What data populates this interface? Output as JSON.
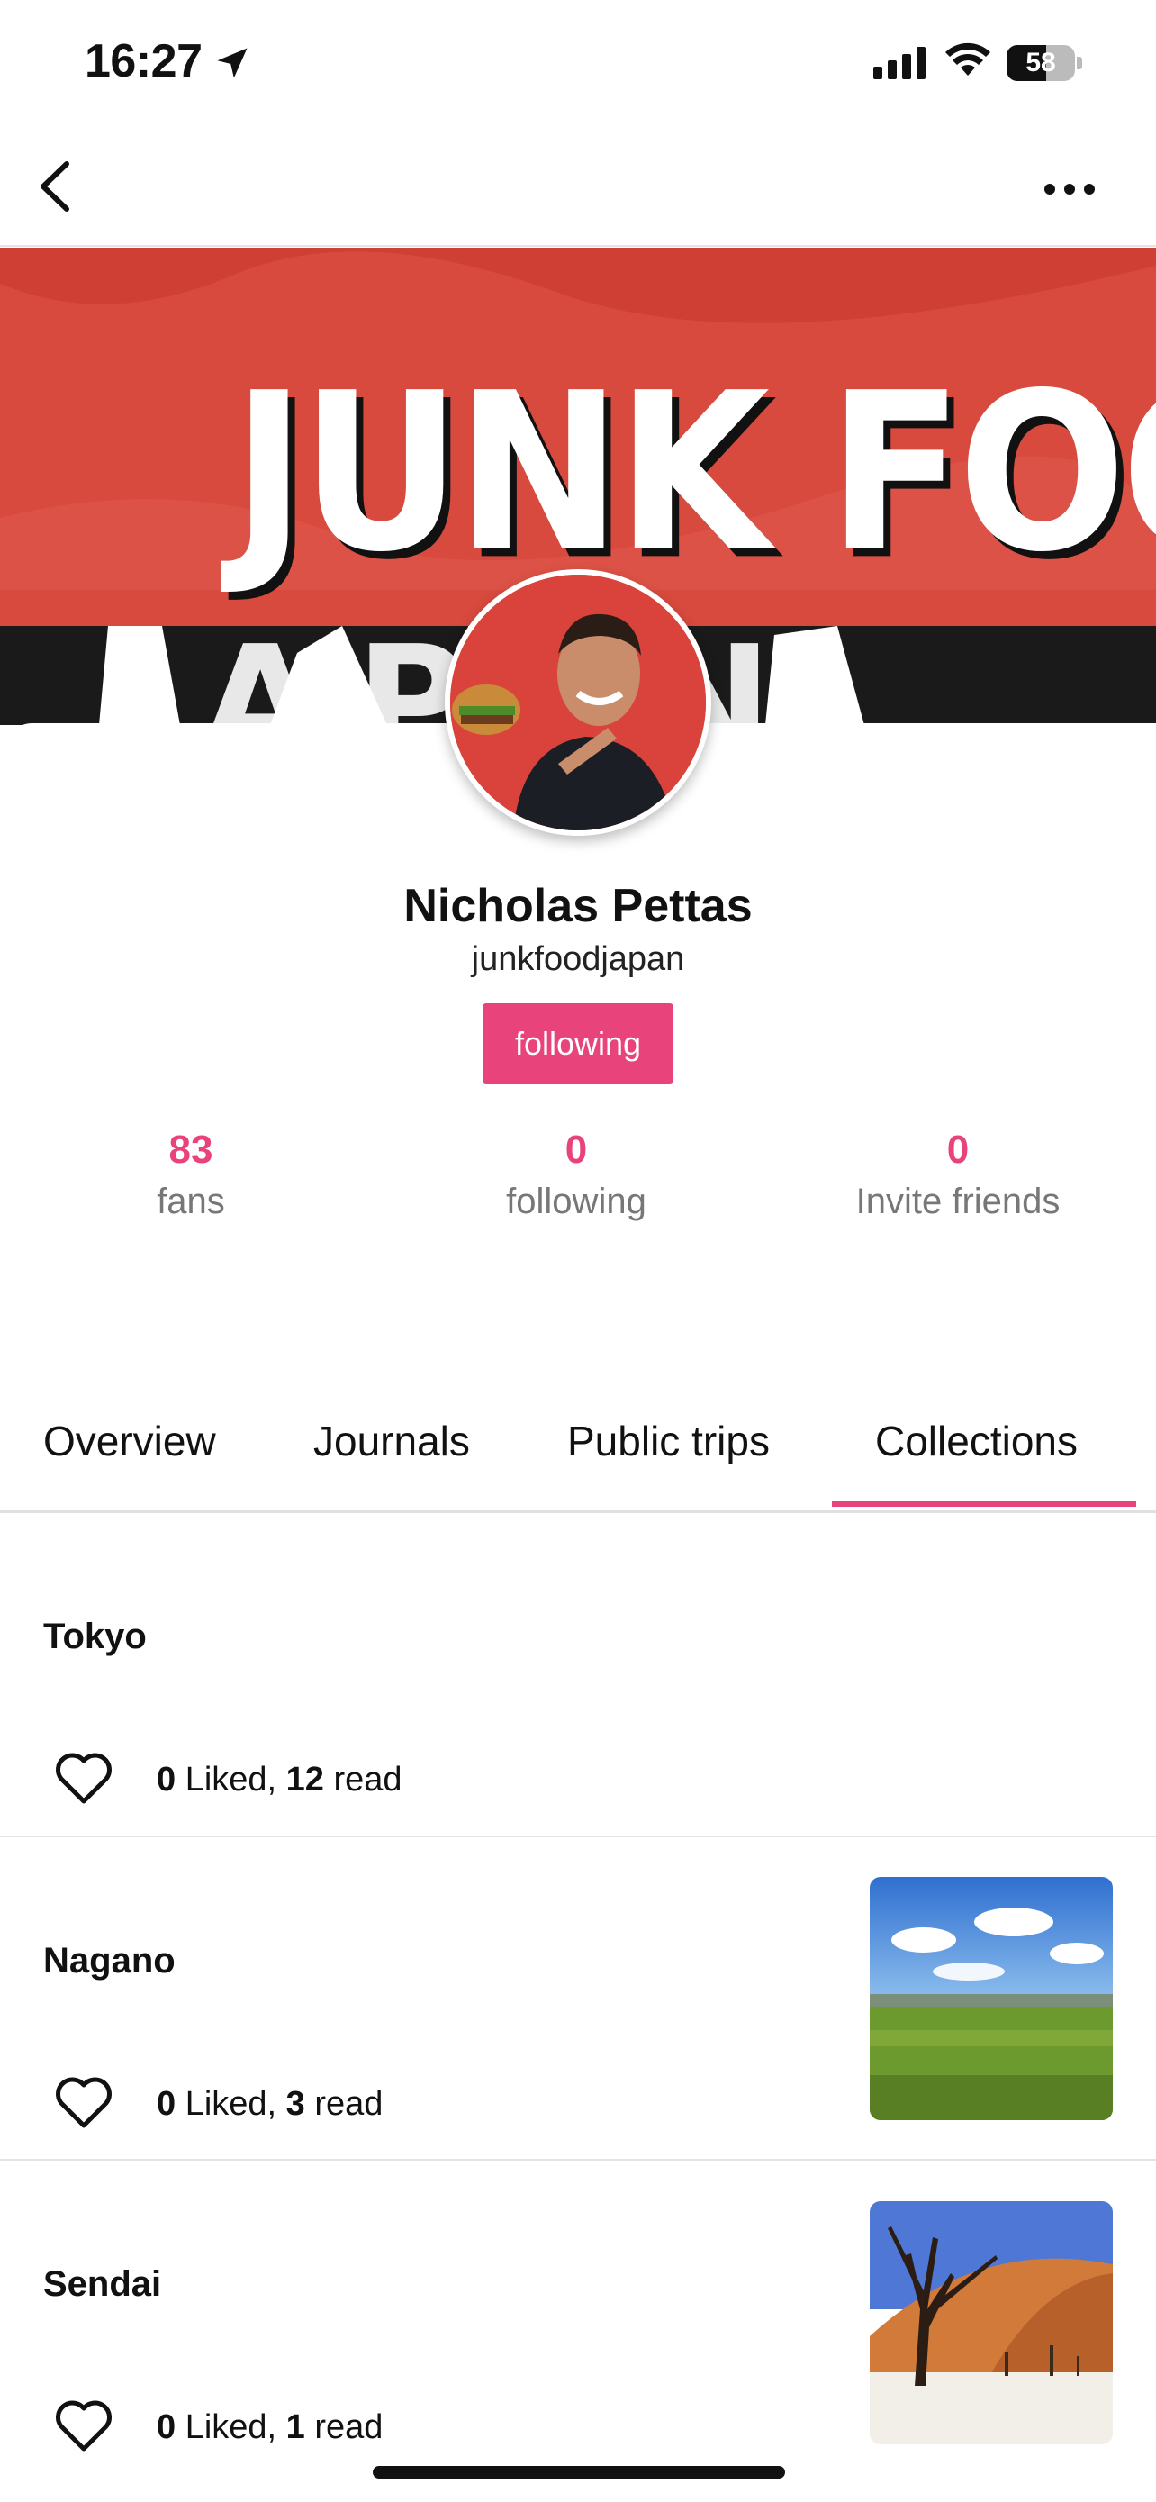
{
  "status_bar": {
    "time": "16:27",
    "battery": "58"
  },
  "cover": {
    "banner_text": "JUNK FOOD",
    "banner_sub_text": "JAPAN",
    "bg_color": "#d84a3e"
  },
  "profile": {
    "name": "Nicholas Pettas",
    "handle": "junkfoodjapan",
    "follow_button": "following",
    "stats": [
      {
        "value": "83",
        "label": "fans"
      },
      {
        "value": "0",
        "label": "following"
      },
      {
        "value": "0",
        "label": "Invite friends"
      }
    ]
  },
  "tabs": [
    {
      "label": "Overview"
    },
    {
      "label": "Journals"
    },
    {
      "label": "Public trips"
    },
    {
      "label": "Collections"
    }
  ],
  "active_tab": "Collections",
  "collections": [
    {
      "title": "Tokyo",
      "liked": "0",
      "liked_label": " Liked, ",
      "read": "12",
      "read_label": " read",
      "thumbnail": "none"
    },
    {
      "title": "Nagano",
      "liked": "0",
      "liked_label": " Liked, ",
      "read": "3",
      "read_label": " read",
      "thumbnail": "green-plain-landscape"
    },
    {
      "title": "Sendai",
      "liked": "0",
      "liked_label": " Liked, ",
      "read": "1",
      "read_label": " read",
      "thumbnail": "desert-dead-tree"
    }
  ],
  "colors": {
    "accent": "#e8437a",
    "text": "#111111",
    "muted": "#777777",
    "divider": "#e4e4e4"
  }
}
